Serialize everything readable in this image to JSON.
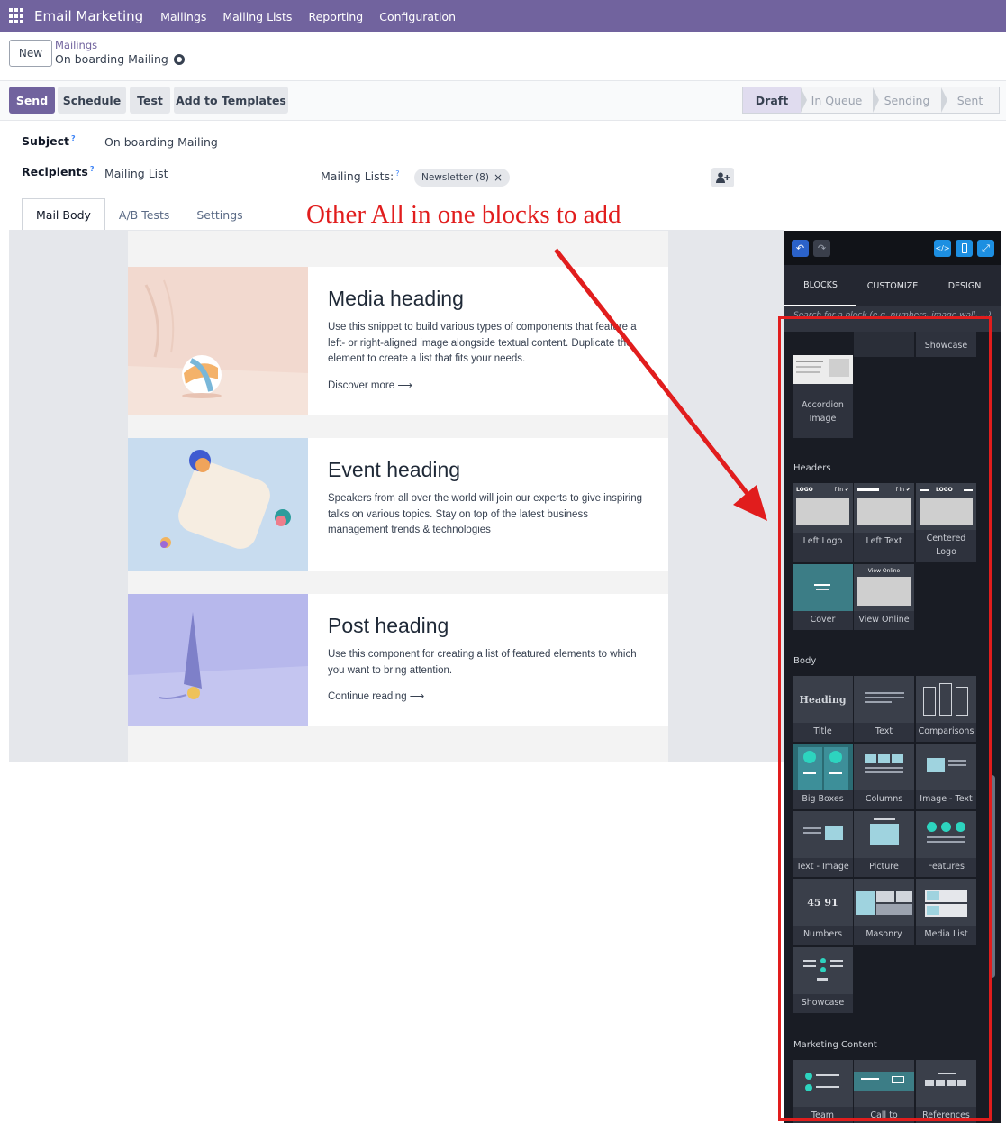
{
  "topbar": {
    "app_name": "Email Marketing",
    "menu": [
      "Mailings",
      "Mailing Lists",
      "Reporting",
      "Configuration"
    ]
  },
  "control": {
    "new_label": "New",
    "breadcrumb_parent": "Mailings",
    "breadcrumb_current": "On boarding Mailing"
  },
  "actions": {
    "send": "Send",
    "schedule": "Schedule",
    "test": "Test",
    "add_to_templates": "Add to Templates"
  },
  "status_bar": {
    "stages": [
      "Draft",
      "In Queue",
      "Sending",
      "Sent"
    ],
    "active": "Draft"
  },
  "form": {
    "subject_label": "Subject",
    "subject_value": "On boarding Mailing",
    "recipients_label": "Recipients",
    "recipients_value": "Mailing List",
    "mailing_lists_label": "Mailing Lists:",
    "help_mark": "?",
    "tag_label": "Newsletter (8)",
    "tag_remove": "×"
  },
  "tabs": [
    "Mail Body",
    "A/B Tests",
    "Settings"
  ],
  "annotation": "Other All in one blocks to add",
  "mail_cards": [
    {
      "heading": "Media heading",
      "body": "Use this snippet to build various types of components that feature a left- or right-aligned image alongside textual content. Duplicate the element to create a list that fits your needs.",
      "link": "Discover more ⟶"
    },
    {
      "heading": "Event heading",
      "body": "Speakers from all over the world will join our experts to give inspiring talks on various topics. Stay on top of the latest business management trends & technologies",
      "link": ""
    },
    {
      "heading": "Post heading",
      "body": "Use this component for creating a list of featured elements to which you want to bring attention.",
      "link": "Continue reading ⟶"
    }
  ],
  "panel": {
    "tabs": [
      "BLOCKS",
      "CUSTOMIZE",
      "DESIGN"
    ],
    "search_placeholder": "Search for a block (e.g. numbers, image wall, ...)",
    "top_partial": "Showcase",
    "accordion": "Accordion Image",
    "sections": {
      "headers": "Headers",
      "body": "Body",
      "marketing": "Marketing Content"
    },
    "header_blocks": [
      "Left Logo",
      "Left Text",
      "Centered Logo",
      "Cover",
      "View Online"
    ],
    "body_blocks": [
      "Title",
      "Text",
      "Comparisons",
      "Big Boxes",
      "Columns",
      "Image - Text",
      "Text - Image",
      "Picture",
      "Features",
      "Numbers",
      "Masonry",
      "Media List",
      "Showcase"
    ],
    "marketing_blocks": [
      "Team",
      "Call to",
      "References"
    ],
    "thumb_texts": {
      "logo": "LOGO",
      "social": "f in ✔",
      "view_online": "View Online",
      "heading": "Heading",
      "numbers": "45  91"
    }
  },
  "colors": {
    "brand": "#71639e",
    "annotation": "#e11d1d",
    "panel_bg": "#191c24",
    "accent_blue": "#1d8fe1"
  }
}
